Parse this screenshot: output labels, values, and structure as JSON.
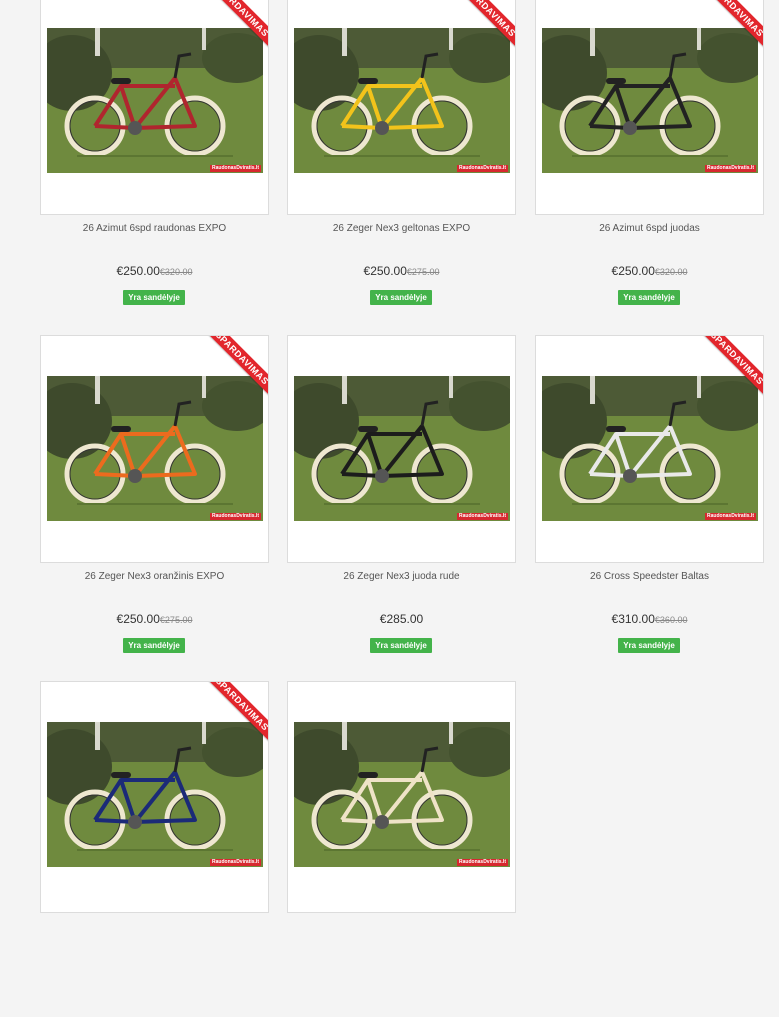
{
  "products": [
    {
      "title": "26 Azimut 6spd raudonas EXPO",
      "price": "€250.00",
      "old_price": "€320.00",
      "stock": "Yra sandėlyje",
      "badge": "IŠPARDAVIMAS",
      "watermark": "RaudonasDviratis.lt",
      "frame_color": "#b0252e"
    },
    {
      "title": "26 Zeger Nex3 geltonas EXPO",
      "price": "€250.00",
      "old_price": "€275.00",
      "stock": "Yra sandėlyje",
      "badge": "IŠPARDAVIMAS",
      "watermark": "RaudonasDviratis.lt",
      "frame_color": "#f2c31b"
    },
    {
      "title": "26 Azimut 6spd juodas",
      "price": "€250.00",
      "old_price": "€320.00",
      "stock": "Yra sandėlyje",
      "badge": "IŠPARDAVIMAS",
      "watermark": "RaudonasDviratis.lt",
      "frame_color": "#222222"
    },
    {
      "title": "26 Zeger Nex3 oranžinis EXPO",
      "price": "€250.00",
      "old_price": "€275.00",
      "stock": "Yra sandėlyje",
      "badge": "IŠPARDAVIMAS",
      "watermark": "RaudonasDviratis.lt",
      "frame_color": "#ec6b1e"
    },
    {
      "title": "26 Zeger Nex3 juoda rude",
      "price": "€285.00",
      "old_price": "",
      "stock": "Yra sandėlyje",
      "badge": "",
      "watermark": "RaudonasDviratis.lt",
      "frame_color": "#1c1c1c"
    },
    {
      "title": "26 Cross Speedster Baltas",
      "price": "€310.00",
      "old_price": "€360.00",
      "stock": "Yra sandėlyje",
      "badge": "IŠPARDAVIMAS",
      "watermark": "RaudonasDviratis.lt",
      "frame_color": "#e9e9e9"
    },
    {
      "title": "",
      "price": "",
      "old_price": "",
      "stock": "",
      "badge": "IŠPARDAVIMAS",
      "watermark": "RaudonasDviratis.lt",
      "frame_color": "#1b2a78"
    },
    {
      "title": "",
      "price": "",
      "old_price": "",
      "stock": "",
      "badge": "",
      "watermark": "RaudonasDviratis.lt",
      "frame_color": "#efe3c7"
    }
  ]
}
